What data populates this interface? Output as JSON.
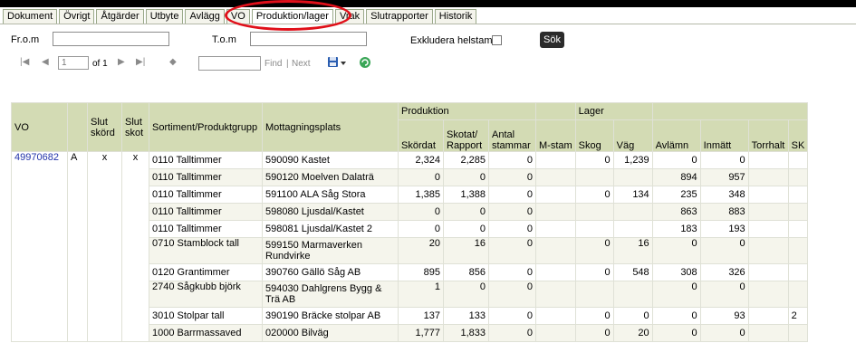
{
  "tabs": [
    "Dokument",
    "Övrigt",
    "Åtgärder",
    "Utbyte",
    "Avlägg",
    "VO",
    "Produktion/lager",
    "Vrak",
    "Slutrapporter",
    "Historik"
  ],
  "filters": {
    "from_label": "Fr.o.m",
    "to_label": "T.o.m",
    "from_value": "",
    "to_value": "",
    "exclude_label": "Exkludera helstam",
    "search_button": "Sök"
  },
  "pager": {
    "page": "1",
    "of_label": "of 1",
    "find_label": "Find",
    "separator": "|",
    "next_label": "Next"
  },
  "table": {
    "group_headers": {
      "production": "Produktion",
      "stock": "Lager"
    },
    "columns": {
      "vo": "VO",
      "blank": "",
      "slut_skord": "Slut skörd",
      "slut_skot": "Slut skot",
      "sortiment": "Sortiment/Produktgrupp",
      "mottagning": "Mottagningsplats",
      "skordat": "Skördat",
      "skotat": "Skotat/ Rapport",
      "antal": "Antal stammar",
      "mstam": "M-stam",
      "skog": "Skog",
      "vag": "Väg",
      "avlamn": "Avlämn",
      "inmatt": "Inmätt",
      "torrhalt": "Torrhalt",
      "sk": "SK"
    },
    "rows": [
      {
        "vo": "49970682",
        "a": "A",
        "slut_skord": "x",
        "slut_skot": "x",
        "sortiment": "0110 Talltimmer",
        "mottagning": "590090 Kastet",
        "skordat": "2,324",
        "skotat": "2,285",
        "antal": "0",
        "mstam": "",
        "skog": "0",
        "vag": "1,239",
        "avlamn": "0",
        "inmatt": "0",
        "torrhalt": "",
        "sk": ""
      },
      {
        "vo": "",
        "a": "",
        "slut_skord": "",
        "slut_skot": "",
        "sortiment": "0110 Talltimmer",
        "mottagning": "590120 Moelven Dalaträ",
        "skordat": "0",
        "skotat": "0",
        "antal": "0",
        "mstam": "",
        "skog": "",
        "vag": "",
        "avlamn": "894",
        "inmatt": "957",
        "torrhalt": "",
        "sk": ""
      },
      {
        "vo": "",
        "a": "",
        "slut_skord": "",
        "slut_skot": "",
        "sortiment": "0110 Talltimmer",
        "mottagning": "591100 ALA Såg Stora",
        "skordat": "1,385",
        "skotat": "1,388",
        "antal": "0",
        "mstam": "",
        "skog": "0",
        "vag": "134",
        "avlamn": "235",
        "inmatt": "348",
        "torrhalt": "",
        "sk": ""
      },
      {
        "vo": "",
        "a": "",
        "slut_skord": "",
        "slut_skot": "",
        "sortiment": "0110 Talltimmer",
        "mottagning": "598080 Ljusdal/Kastet",
        "skordat": "0",
        "skotat": "0",
        "antal": "0",
        "mstam": "",
        "skog": "",
        "vag": "",
        "avlamn": "863",
        "inmatt": "883",
        "torrhalt": "",
        "sk": ""
      },
      {
        "vo": "",
        "a": "",
        "slut_skord": "",
        "slut_skot": "",
        "sortiment": "0110 Talltimmer",
        "mottagning": "598081 Ljusdal/Kastet 2",
        "skordat": "0",
        "skotat": "0",
        "antal": "0",
        "mstam": "",
        "skog": "",
        "vag": "",
        "avlamn": "183",
        "inmatt": "193",
        "torrhalt": "",
        "sk": ""
      },
      {
        "vo": "",
        "a": "",
        "slut_skord": "",
        "slut_skot": "",
        "sortiment": "0710 Stamblock tall",
        "mottagning": "599150 Marmaverken Rundvirke",
        "skordat": "20",
        "skotat": "16",
        "antal": "0",
        "mstam": "",
        "skog": "0",
        "vag": "16",
        "avlamn": "0",
        "inmatt": "0",
        "torrhalt": "",
        "sk": ""
      },
      {
        "vo": "",
        "a": "",
        "slut_skord": "",
        "slut_skot": "",
        "sortiment": "0120 Grantimmer",
        "mottagning": "390760 Gällö Såg AB",
        "skordat": "895",
        "skotat": "856",
        "antal": "0",
        "mstam": "",
        "skog": "0",
        "vag": "548",
        "avlamn": "308",
        "inmatt": "326",
        "torrhalt": "",
        "sk": ""
      },
      {
        "vo": "",
        "a": "",
        "slut_skord": "",
        "slut_skot": "",
        "sortiment": "2740 Sågkubb björk",
        "mottagning": "594030 Dahlgrens Bygg & Trä AB",
        "skordat": "1",
        "skotat": "0",
        "antal": "0",
        "mstam": "",
        "skog": "",
        "vag": "",
        "avlamn": "0",
        "inmatt": "0",
        "torrhalt": "",
        "sk": ""
      },
      {
        "vo": "",
        "a": "",
        "slut_skord": "",
        "slut_skot": "",
        "sortiment": "3010 Stolpar tall",
        "mottagning": "390190 Bräcke stolpar AB",
        "skordat": "137",
        "skotat": "133",
        "antal": "0",
        "mstam": "",
        "skog": "0",
        "vag": "0",
        "avlamn": "0",
        "inmatt": "93",
        "torrhalt": "",
        "sk": "2"
      },
      {
        "vo": "",
        "a": "",
        "slut_skord": "",
        "slut_skot": "",
        "sortiment": "1000 Barrmassaved",
        "mottagning": "020000 Bilväg",
        "skordat": "1,777",
        "skotat": "1,833",
        "antal": "0",
        "mstam": "",
        "skog": "0",
        "vag": "20",
        "avlamn": "0",
        "inmatt": "0",
        "torrhalt": "",
        "sk": ""
      }
    ]
  }
}
